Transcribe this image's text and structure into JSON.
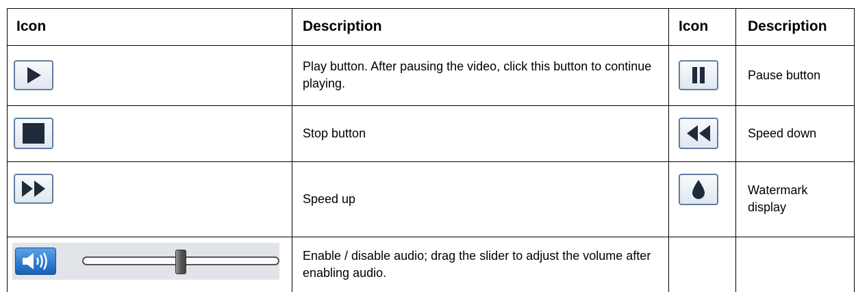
{
  "table": {
    "headers": [
      "Icon",
      "Description",
      "Icon",
      "Description"
    ],
    "rows": [
      {
        "left_icon": "play-icon",
        "left_description": "Play button. After pausing the video, click this button to continue playing.",
        "right_icon": "pause-icon",
        "right_description": "Pause button"
      },
      {
        "left_icon": "stop-icon",
        "left_description": "Stop button",
        "right_icon": "rewind-icon",
        "right_description": "Speed down"
      },
      {
        "left_icon": "fast-forward-icon",
        "left_description": "Speed up",
        "right_icon": "water-drop-icon",
        "right_description": "Watermark display"
      },
      {
        "left_icon": "speaker-icon",
        "left_description": "Enable / disable audio; drag the slider to adjust the volume after enabling audio.",
        "right_icon": "",
        "right_description": ""
      }
    ]
  },
  "volume_slider": {
    "level": 0.5
  },
  "colors": {
    "button_border": "#5f7d9e",
    "icon_fill": "#1f2a3a",
    "speaker_blue": "#1560b8",
    "slider_background": "#e1e4e8"
  }
}
